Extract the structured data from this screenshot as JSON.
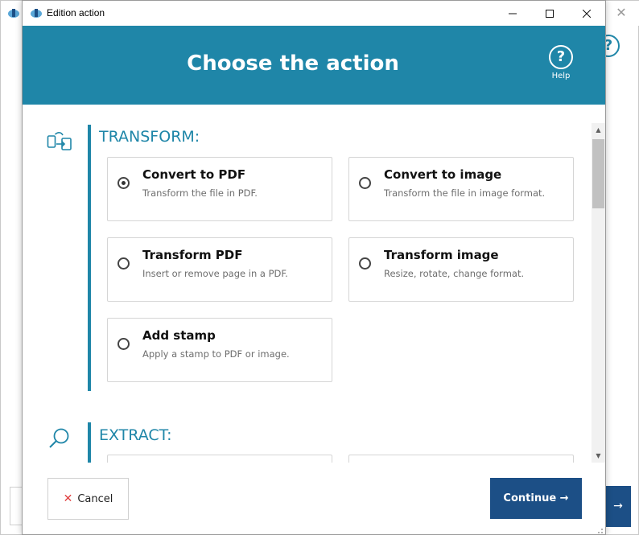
{
  "window": {
    "title": "Edition action",
    "minimize_glyph": "—",
    "maximize_glyph": "☐",
    "close_glyph": "✕"
  },
  "background_window": {
    "close_glyph": "✕",
    "help_glyph": "?",
    "arrow_glyph": "→"
  },
  "header": {
    "title": "Choose the action",
    "help_glyph": "?",
    "help_label": "Help",
    "background_color": "#1f86a8"
  },
  "sections": [
    {
      "title": "TRANSFORM:",
      "icon": "transform-icon",
      "options": [
        {
          "title": "Convert to PDF",
          "description": "Transform the file in PDF.",
          "selected": true
        },
        {
          "title": "Convert to image",
          "description": "Transform the file in image format.",
          "selected": false
        },
        {
          "title": "Transform PDF",
          "description": "Insert or remove page in a PDF.",
          "selected": false
        },
        {
          "title": "Transform image",
          "description": "Resize, rotate, change format.",
          "selected": false
        },
        {
          "title": "Add stamp",
          "description": "Apply a stamp to PDF or image.",
          "selected": false
        }
      ]
    },
    {
      "title": "EXTRACT:",
      "icon": "search-icon",
      "options": []
    }
  ],
  "footer": {
    "cancel_icon": "✕",
    "cancel_label": "Cancel",
    "continue_label": "Continue →"
  },
  "colors": {
    "accent": "#1f86a8",
    "primary_button": "#1c4f86",
    "cancel_icon": "#e04040"
  }
}
